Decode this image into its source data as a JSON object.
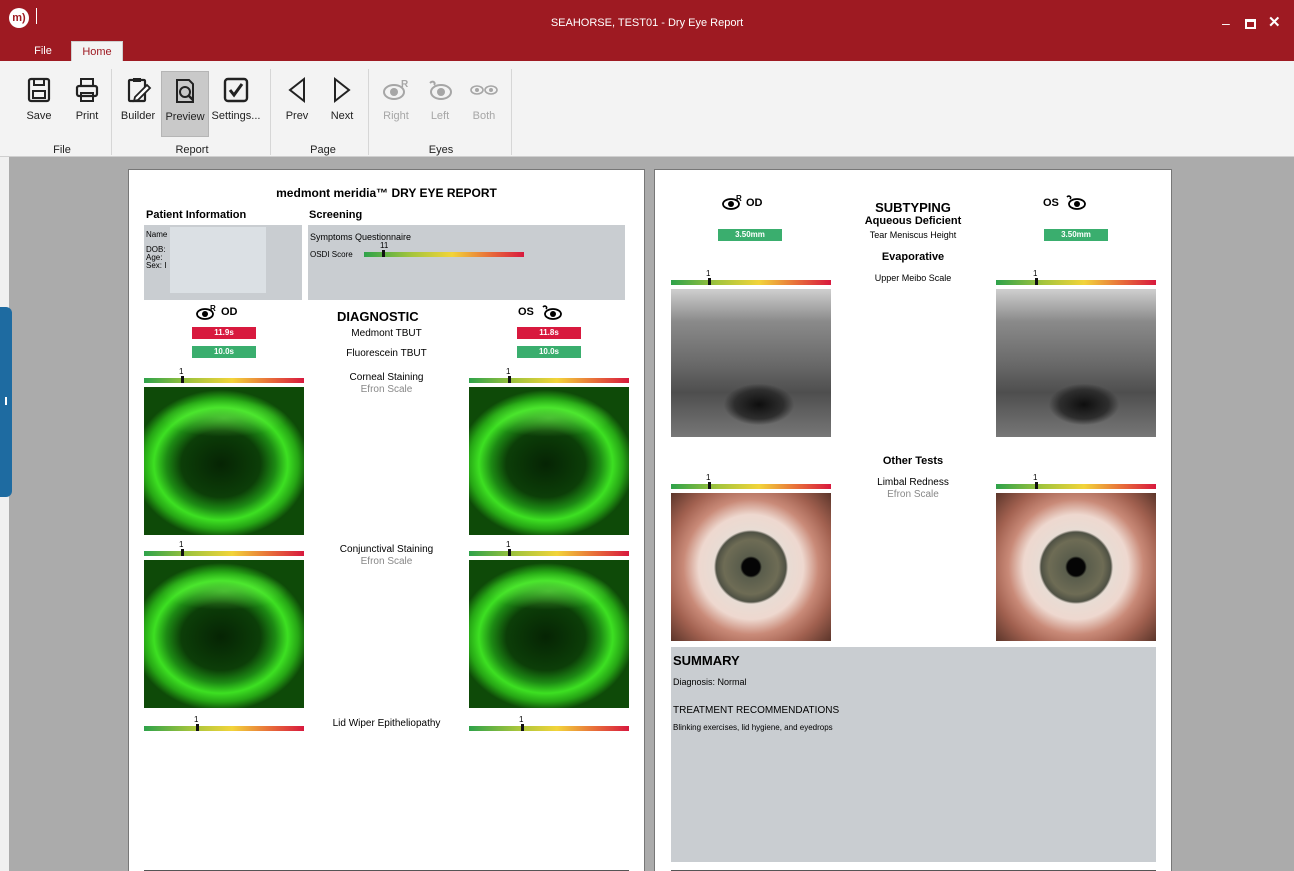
{
  "window": {
    "title": "SEAHORSE, TEST01 - Dry Eye Report",
    "logo": "m)"
  },
  "menu": {
    "file": "File",
    "home": "Home"
  },
  "ribbon": {
    "buttons": {
      "save": "Save",
      "print": "Print",
      "builder": "Builder",
      "preview": "Preview",
      "settings": "Settings...",
      "prev": "Prev",
      "next": "Next",
      "right": "Right",
      "left": "Left",
      "both": "Both"
    },
    "groups": {
      "file": "File",
      "report": "Report",
      "page": "Page",
      "eyes": "Eyes"
    }
  },
  "report": {
    "title": "medmont meridia™ DRY EYE REPORT",
    "patient": {
      "heading": "Patient Information",
      "name": "Name",
      "dob": "DOB:",
      "age": "Age:",
      "sex": "Sex: I"
    },
    "screening": {
      "heading": "Screening",
      "questionnaire": "Symptoms Questionnaire",
      "osdi_label": "OSDI Score",
      "osdi_value": "11",
      "osdi_fraction": 0.12
    },
    "eyes": {
      "od": "OD",
      "os": "OS"
    },
    "diagnostic": {
      "heading": "DIAGNOSTIC",
      "medmont_tbut": {
        "label": "Medmont TBUT",
        "od": "11.9s",
        "os": "11.8s"
      },
      "fluorescein_tbut": {
        "label": "Fluorescein TBUT",
        "od": "10.0s",
        "os": "10.0s"
      },
      "corneal_staining": {
        "label": "Corneal Staining",
        "sub": "Efron Scale",
        "od": "1",
        "os": "1",
        "od_fraction": 0.24,
        "os_fraction": 0.25
      },
      "conjunctival_staining": {
        "label": "Conjunctival Staining",
        "sub": "Efron Scale",
        "od": "1",
        "os": "1",
        "od_fraction": 0.24,
        "os_fraction": 0.25
      },
      "lid_wiper": {
        "label": "Lid Wiper Epitheliopathy",
        "od": "1",
        "os": "1",
        "od_fraction": 0.33,
        "os_fraction": 0.33
      }
    },
    "subtyping": {
      "heading": "SUBTYPING",
      "aqueous": "Aqueous Deficient",
      "tmh": {
        "label": "Tear Meniscus Height",
        "od": "3.50mm",
        "os": "3.50mm"
      },
      "evaporative": "Evaporative",
      "meibo": {
        "label": "Upper Meibo Scale",
        "od": "1",
        "os": "1",
        "od_fraction": 0.24,
        "os_fraction": 0.25
      }
    },
    "other": {
      "heading": "Other Tests",
      "limbal": {
        "label": "Limbal Redness",
        "sub": "Efron Scale",
        "od": "1",
        "os": "1",
        "od_fraction": 0.24,
        "os_fraction": 0.25
      }
    },
    "summary": {
      "heading": "SUMMARY",
      "diagnosis": "Diagnosis: Normal",
      "treatment_heading": "TREATMENT RECOMMENDATIONS",
      "treatment": "Blinking exercises, lid hygiene, and eyedrops"
    }
  },
  "icons": {
    "save": "floppy-disk-icon",
    "print": "printer-icon",
    "builder": "clipboard-pencil-icon",
    "preview": "document-magnifier-icon",
    "settings": "checkbox-icon",
    "prev": "triangle-left-icon",
    "next": "triangle-right-icon",
    "right_eye": "right-eye-icon",
    "left_eye": "left-eye-icon",
    "both_eyes": "both-eyes-icon"
  },
  "colors": {
    "brand": "#9e1a22",
    "value_red": "#d8193e",
    "value_green": "#3aae6e",
    "panel_gray": "#c9cdd1"
  }
}
